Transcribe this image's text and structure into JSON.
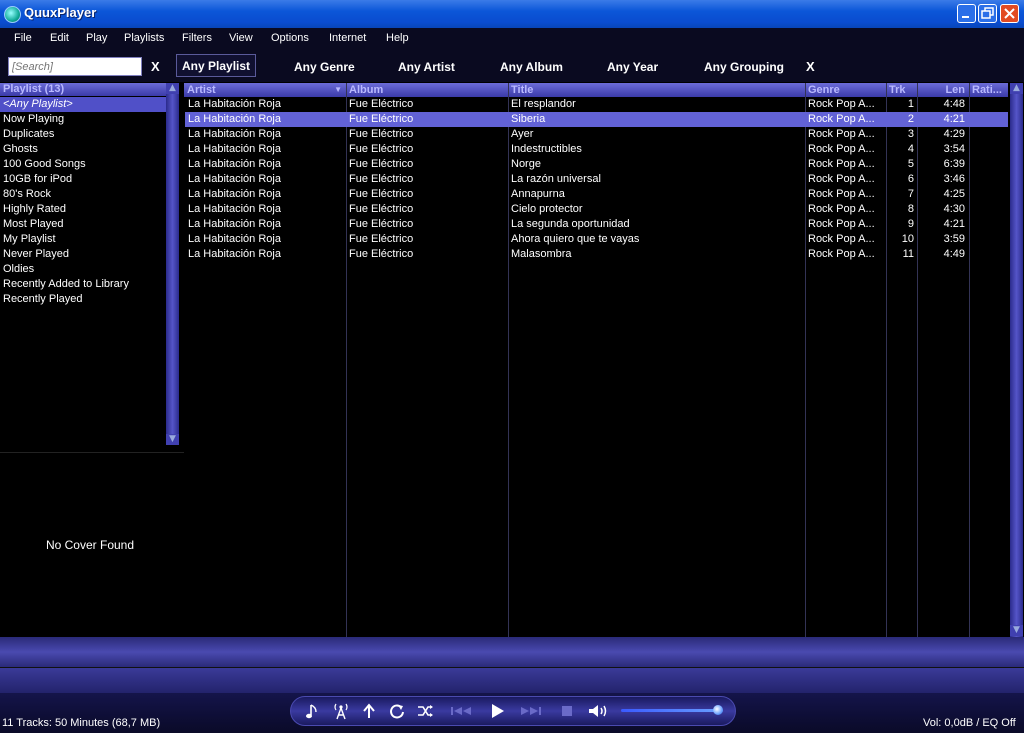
{
  "window": {
    "title": "QuuxPlayer"
  },
  "menu": [
    "File",
    "Edit",
    "Play",
    "Playlists",
    "Filters",
    "View",
    "Options",
    "Internet",
    "Help"
  ],
  "search": {
    "placeholder": "[Search]",
    "clear_label": "X"
  },
  "filters": [
    "Any Playlist",
    "Any Genre",
    "Any Artist",
    "Any Album",
    "Any Year",
    "Any Grouping"
  ],
  "filters_clear_label": "X",
  "playlists": {
    "header": "Playlist (13)",
    "items": [
      "<Any Playlist>",
      "Now Playing",
      "Duplicates",
      "Ghosts",
      "100 Good Songs",
      "10GB for iPod",
      "80's Rock",
      "Highly Rated",
      "Most Played",
      "My Playlist",
      "Never Played",
      "Oldies",
      "Recently Added to Library",
      "Recently Played"
    ],
    "selected_index": 0
  },
  "cover": {
    "text": "No Cover Found"
  },
  "table": {
    "columns": [
      "Artist",
      "Album",
      "Title",
      "Genre",
      "Trk",
      "Len",
      "Rati..."
    ],
    "sort_indicator": "▼",
    "selected_index": 1,
    "rows": [
      {
        "artist": "La Habitación Roja",
        "album": "Fue Eléctrico",
        "title": "El resplandor",
        "genre": "Rock Pop A...",
        "trk": "1",
        "len": "4:48"
      },
      {
        "artist": "La Habitación Roja",
        "album": "Fue Eléctrico",
        "title": "Siberia",
        "genre": "Rock Pop A...",
        "trk": "2",
        "len": "4:21"
      },
      {
        "artist": "La Habitación Roja",
        "album": "Fue Eléctrico",
        "title": "Ayer",
        "genre": "Rock Pop A...",
        "trk": "3",
        "len": "4:29"
      },
      {
        "artist": "La Habitación Roja",
        "album": "Fue Eléctrico",
        "title": "Indestructibles",
        "genre": "Rock Pop A...",
        "trk": "4",
        "len": "3:54"
      },
      {
        "artist": "La Habitación Roja",
        "album": "Fue Eléctrico",
        "title": "Norge",
        "genre": "Rock Pop A...",
        "trk": "5",
        "len": "6:39"
      },
      {
        "artist": "La Habitación Roja",
        "album": "Fue Eléctrico",
        "title": "La razón universal",
        "genre": "Rock Pop A...",
        "trk": "6",
        "len": "3:46"
      },
      {
        "artist": "La Habitación Roja",
        "album": "Fue Eléctrico",
        "title": "Annapurna",
        "genre": "Rock Pop A...",
        "trk": "7",
        "len": "4:25"
      },
      {
        "artist": "La Habitación Roja",
        "album": "Fue Eléctrico",
        "title": "Cielo protector",
        "genre": "Rock Pop A...",
        "trk": "8",
        "len": "4:30"
      },
      {
        "artist": "La Habitación Roja",
        "album": "Fue Eléctrico",
        "title": "La segunda oportunidad",
        "genre": "Rock Pop A...",
        "trk": "9",
        "len": "4:21"
      },
      {
        "artist": "La Habitación Roja",
        "album": "Fue Eléctrico",
        "title": "Ahora quiero que te vayas",
        "genre": "Rock Pop A...",
        "trk": "10",
        "len": "3:59"
      },
      {
        "artist": "La Habitación Roja",
        "album": "Fue Eléctrico",
        "title": "Malasombra",
        "genre": "Rock Pop A...",
        "trk": "11",
        "len": "4:49"
      }
    ]
  },
  "status": {
    "summary": "11 Tracks: 50 Minutes (68,7 MB)",
    "volume": "Vol: 0,0dB / EQ Off"
  },
  "transport": {
    "volume_level": 0.95,
    "icons": [
      "music-note-icon",
      "radio-icon",
      "up-arrow-icon",
      "repeat-icon",
      "shuffle-icon",
      "previous-icon",
      "play-icon",
      "next-icon",
      "stop-icon",
      "volume-icon"
    ]
  },
  "colors": {
    "titlebar": "#0b56d8",
    "selection": "#6262d6",
    "header_text": "#b9b9ff",
    "accent": "#4a4ab0"
  }
}
